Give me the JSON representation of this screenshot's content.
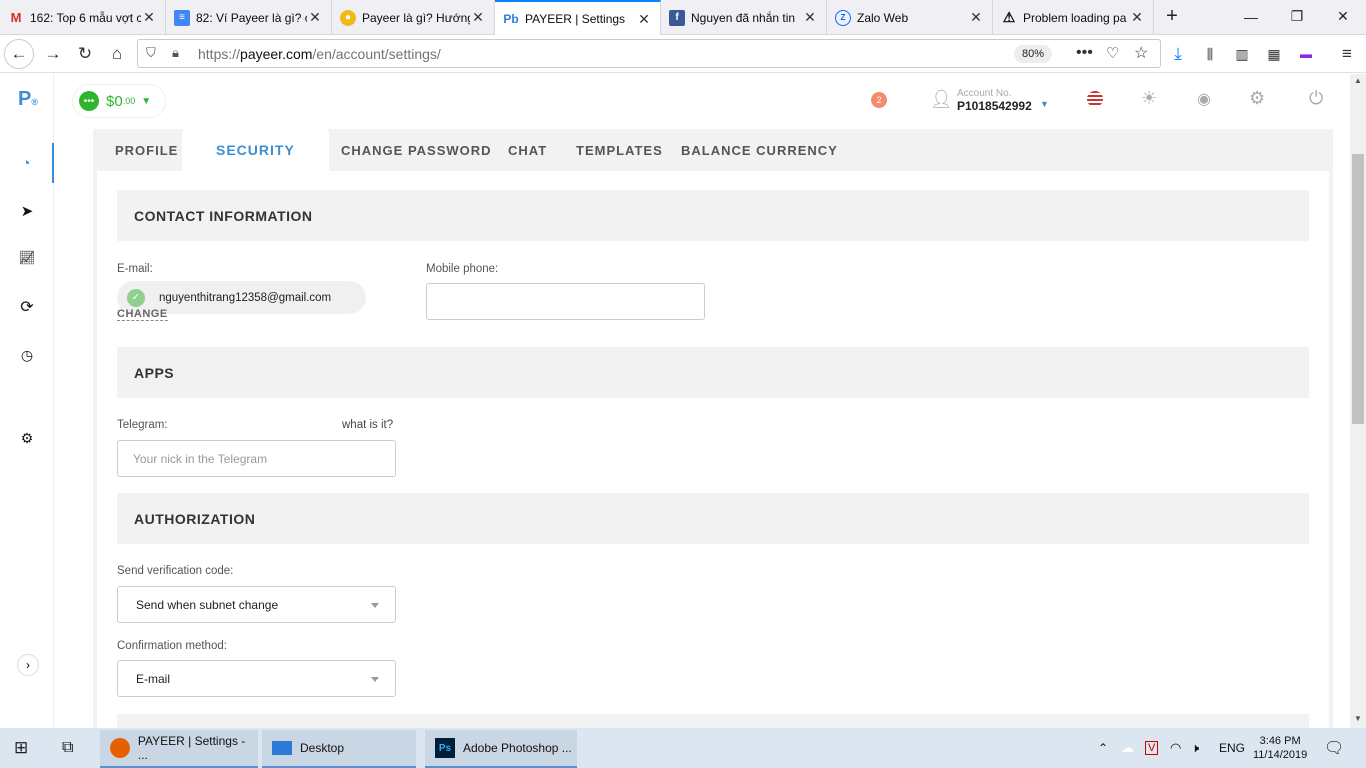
{
  "browser": {
    "tabs": [
      {
        "title": "162: Top 6 mẫu vợt c",
        "icon": "gmail-icon",
        "fav": "M",
        "fav_color": "#d93025"
      },
      {
        "title": "82: Ví Payeer là gì? c",
        "icon": "docs-icon",
        "fav": "≡",
        "fav_color": "#4285f4"
      },
      {
        "title": "Payeer là gì? Hướng",
        "icon": "coin-icon",
        "fav": "●",
        "fav_color": "#f2b91a"
      },
      {
        "title": "PAYEER | Settings",
        "icon": "payeer-icon",
        "fav": "Pb",
        "fav_color": "#2a7fd4"
      },
      {
        "title": "Nguyen đã nhắn tin",
        "icon": "facebook-icon",
        "fav": "f",
        "fav_color": "#3b5998"
      },
      {
        "title": "Zalo Web",
        "icon": "zalo-icon",
        "fav": "Z",
        "fav_color": "#0068ff"
      },
      {
        "title": "Problem loading pa",
        "icon": "warning-icon",
        "fav": "⚠",
        "fav_color": "#222"
      }
    ],
    "url_prefix": "https://",
    "url_host": "payeer.com",
    "url_path": "/en/account/settings/",
    "zoom": "80%"
  },
  "topbar": {
    "balance_main": "$0",
    "balance_cents": ".00",
    "notification_count": "2",
    "account_label": "Account No.",
    "account_number": "P1018542992"
  },
  "tabs": {
    "profile": "PROFILE",
    "security": "SECURITY",
    "change_password": "CHANGE PASSWORD",
    "chat": "CHAT",
    "templates": "TEMPLATES",
    "balance_currency": "BALANCE CURRENCY"
  },
  "contact": {
    "heading": "CONTACT INFORMATION",
    "email_label": "E-mail:",
    "email_value": "nguyenthitrang12358@gmail.com",
    "change_link": "CHANGE",
    "phone_label": "Mobile phone:",
    "phone_value": ""
  },
  "apps": {
    "heading": "APPS",
    "telegram_label": "Telegram:",
    "what_is_it": "what is it?",
    "telegram_placeholder": "Your nick in the Telegram"
  },
  "authorization": {
    "heading": "AUTHORIZATION",
    "send_code_label": "Send verification code:",
    "send_code_value": "Send when subnet change",
    "confirm_label": "Confirmation method:",
    "confirm_value": "E-mail"
  },
  "taskbar": {
    "apps": [
      {
        "label": "PAYEER | Settings - ...",
        "icon": "firefox-icon"
      },
      {
        "label": "Desktop",
        "icon": "desktop-icon"
      },
      {
        "label": "Adobe Photoshop ...",
        "icon": "photoshop-icon"
      }
    ],
    "language": "ENG",
    "time": "3:46 PM",
    "date": "11/14/2019"
  }
}
